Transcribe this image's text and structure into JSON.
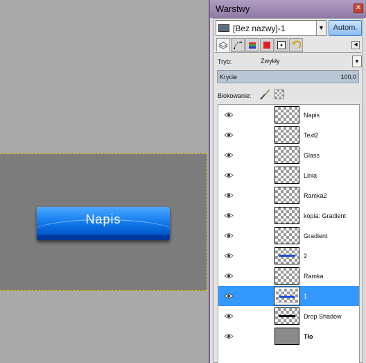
{
  "canvas": {
    "button_text": "Napis"
  },
  "dock": {
    "title": "Warstwy",
    "close_glyph": "✕",
    "image_selector": {
      "value": "[Bez nazwy]-1",
      "icon": "image-thumb-icon"
    },
    "auto_button": "Autom.",
    "tabs": [
      {
        "icon": "layers-tab-icon"
      },
      {
        "icon": "paths-tab-icon"
      },
      {
        "icon": "colormap-tab-icon"
      },
      {
        "icon": "color-red-tab-icon"
      },
      {
        "icon": "pointer-tab-icon"
      },
      {
        "icon": "undo-history-tab-icon"
      }
    ],
    "mode_label": "Tryb:",
    "mode_value": "Zwykły",
    "opacity_label": "Krycie",
    "opacity_value": "100,0",
    "lock_label": "Blokowanie:",
    "selected_color": "#3399ff",
    "layers": [
      {
        "name": "Napis",
        "thumb": "checker"
      },
      {
        "name": "Text2",
        "thumb": "checker"
      },
      {
        "name": "Glass",
        "thumb": "checker"
      },
      {
        "name": "Linia",
        "thumb": "checker"
      },
      {
        "name": "Ramka2",
        "thumb": "checker"
      },
      {
        "name": "kopia: Gradient",
        "thumb": "checker"
      },
      {
        "name": "Gradient",
        "thumb": "checker"
      },
      {
        "name": "2",
        "thumb": "blue-line"
      },
      {
        "name": "Ramka",
        "thumb": "checker"
      },
      {
        "name": "1",
        "thumb": "blue-line",
        "selected": true
      },
      {
        "name": "Drop Shadow",
        "thumb": "black-line"
      },
      {
        "name": "Tło",
        "thumb": "solid",
        "bold": true
      }
    ],
    "bottom_buttons": [
      {
        "icon": "new-layer-icon"
      },
      {
        "icon": "new-layer-group-icon"
      },
      {
        "icon": "raise-layer-icon"
      },
      {
        "icon": "lower-layer-icon"
      },
      {
        "icon": "duplicate-layer-icon"
      },
      {
        "icon": "anchor-layer-icon"
      },
      {
        "icon": "delete-layer-icon"
      }
    ]
  }
}
